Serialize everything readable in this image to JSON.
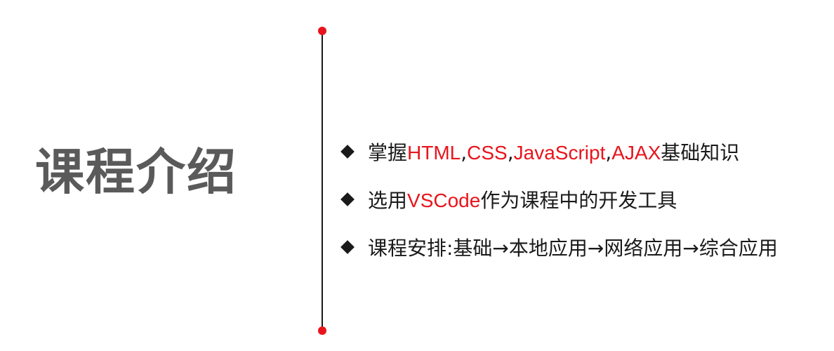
{
  "title": "课程介绍",
  "colors": {
    "accent": "#e8141c",
    "title": "#5a5a5a",
    "text": "#1a1a1a"
  },
  "bullets": [
    {
      "segments": [
        {
          "text": "掌握",
          "accent": false
        },
        {
          "text": "HTML",
          "accent": true
        },
        {
          "text": ",",
          "accent": false
        },
        {
          "text": "CSS",
          "accent": true
        },
        {
          "text": ",",
          "accent": false
        },
        {
          "text": "JavaScript",
          "accent": true
        },
        {
          "text": ",",
          "accent": false
        },
        {
          "text": "AJAX",
          "accent": true
        },
        {
          "text": "基础知识",
          "accent": false
        }
      ]
    },
    {
      "segments": [
        {
          "text": "选用",
          "accent": false
        },
        {
          "text": "VSCode",
          "accent": true
        },
        {
          "text": "作为课程中的开发工具",
          "accent": false
        }
      ]
    },
    {
      "segments": [
        {
          "text": "课程安排:基础→本地应用→网络应用→综合应用",
          "accent": false
        }
      ]
    }
  ]
}
